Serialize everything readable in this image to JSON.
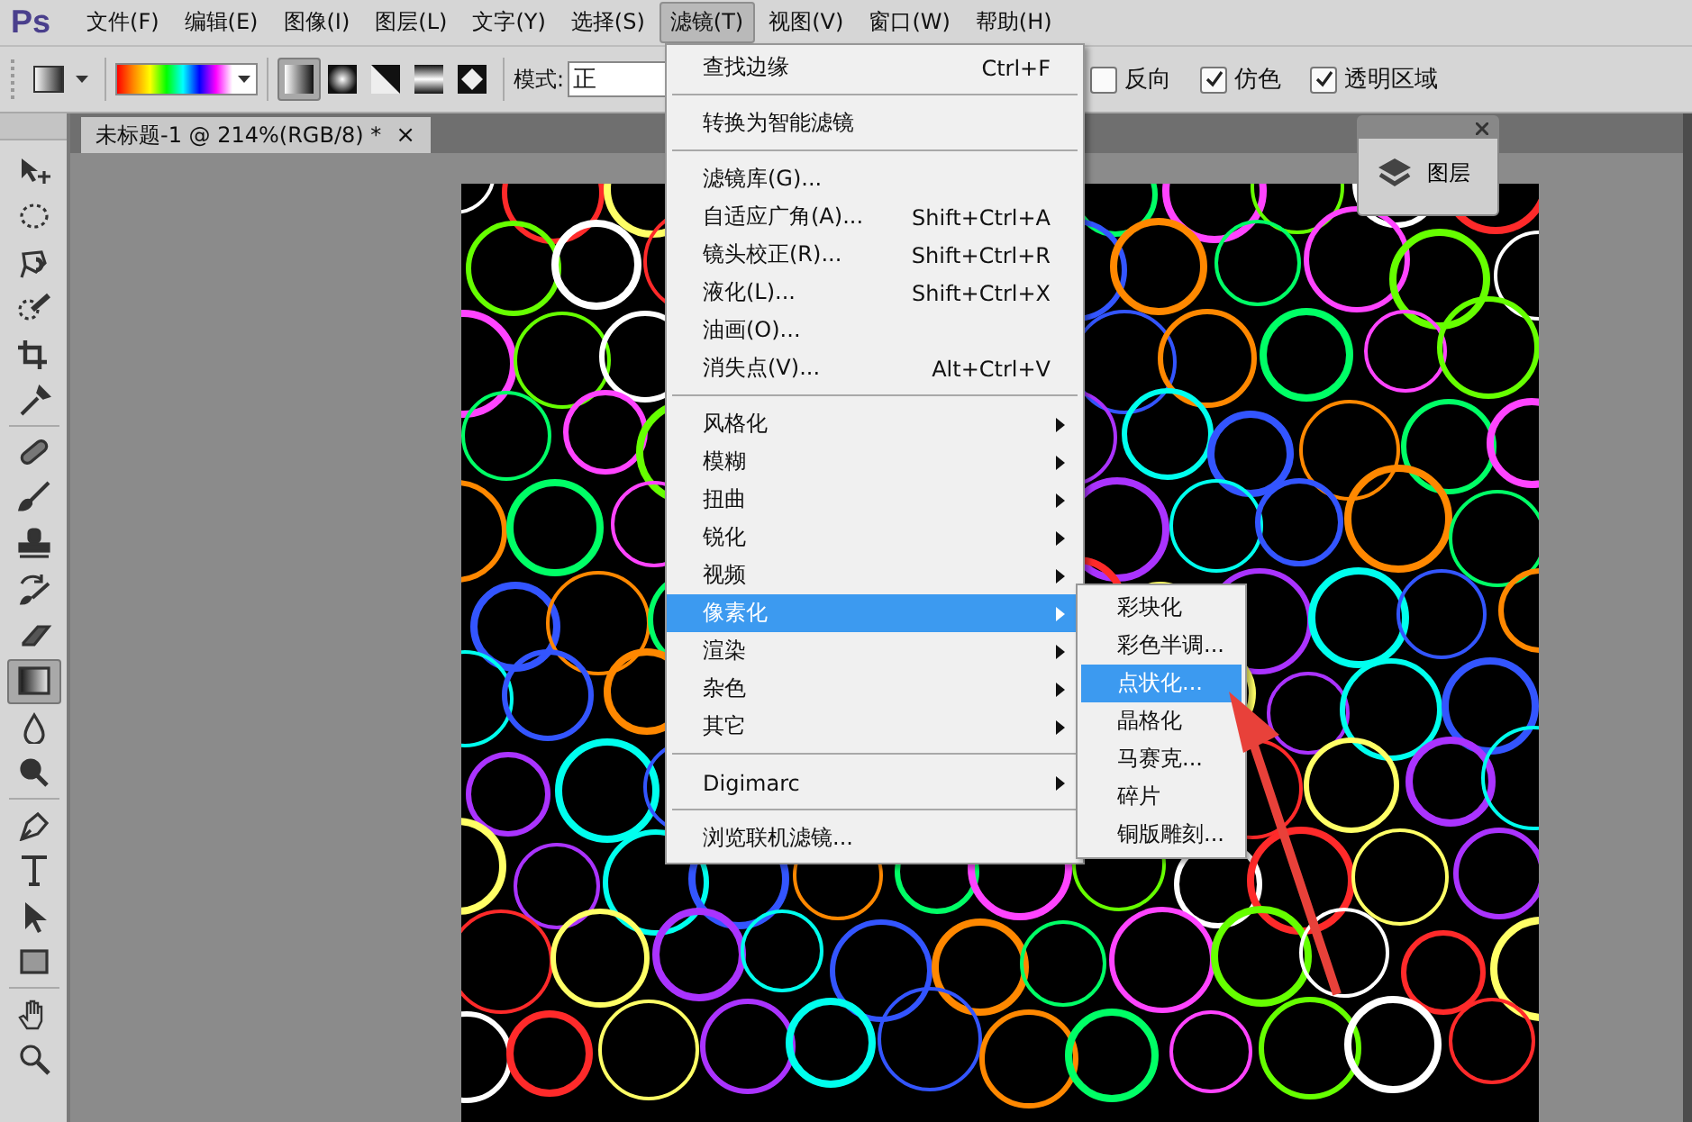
{
  "app_logo": "Ps",
  "menubar": [
    {
      "label": "文件(F)",
      "selected": false
    },
    {
      "label": "编辑(E)",
      "selected": false
    },
    {
      "label": "图像(I)",
      "selected": false
    },
    {
      "label": "图层(L)",
      "selected": false
    },
    {
      "label": "文字(Y)",
      "selected": false
    },
    {
      "label": "选择(S)",
      "selected": false
    },
    {
      "label": "滤镜(T)",
      "selected": true
    },
    {
      "label": "视图(V)",
      "selected": false
    },
    {
      "label": "窗口(W)",
      "selected": false
    },
    {
      "label": "帮助(H)",
      "selected": false
    }
  ],
  "options_bar": {
    "gradient_types": [
      {
        "kind": "linear",
        "selected": true
      },
      {
        "kind": "radial",
        "selected": false
      },
      {
        "kind": "angle",
        "selected": false
      },
      {
        "kind": "reflected",
        "selected": false
      },
      {
        "kind": "diamond",
        "selected": false
      }
    ],
    "mode_label": "模式:",
    "mode_value": "正",
    "checkboxes": [
      {
        "label": "反向",
        "checked": false
      },
      {
        "label": "仿色",
        "checked": true
      },
      {
        "label": "透明区域",
        "checked": true
      }
    ]
  },
  "document_tab": {
    "title": "未标题-1 @ 214%(RGB/8) *",
    "close": "×"
  },
  "tools": [
    {
      "kind": "move",
      "selected": false
    },
    {
      "kind": "marquee",
      "selected": false
    },
    {
      "kind": "lasso",
      "selected": false
    },
    {
      "kind": "quick-select",
      "selected": false
    },
    {
      "kind": "crop",
      "selected": false
    },
    {
      "kind": "eyedropper",
      "selected": false
    },
    {
      "kind": "sep"
    },
    {
      "kind": "healing",
      "selected": false
    },
    {
      "kind": "brush",
      "selected": false
    },
    {
      "kind": "stamp",
      "selected": false
    },
    {
      "kind": "history",
      "selected": false
    },
    {
      "kind": "eraser",
      "selected": false
    },
    {
      "kind": "gradient",
      "selected": true
    },
    {
      "kind": "blur",
      "selected": false
    },
    {
      "kind": "dodge",
      "selected": false
    },
    {
      "kind": "sep"
    },
    {
      "kind": "pen",
      "selected": false
    },
    {
      "kind": "type",
      "selected": false
    },
    {
      "kind": "path-select",
      "selected": false
    },
    {
      "kind": "rectangle",
      "selected": false
    },
    {
      "kind": "sep"
    },
    {
      "kind": "hand",
      "selected": false
    },
    {
      "kind": "zoom",
      "selected": false
    }
  ],
  "layers_panel": {
    "label": "图层"
  },
  "filter_menu": [
    [
      {
        "label": "查找边缘",
        "shortcut": "Ctrl+F",
        "submenu": false,
        "selected": false
      }
    ],
    [
      {
        "label": "转换为智能滤镜",
        "submenu": false,
        "selected": false
      }
    ],
    [
      {
        "label": "滤镜库(G)...",
        "submenu": false,
        "selected": false
      },
      {
        "label": "自适应广角(A)...",
        "shortcut": "Shift+Ctrl+A",
        "submenu": false,
        "selected": false
      },
      {
        "label": "镜头校正(R)...",
        "shortcut": "Shift+Ctrl+R",
        "submenu": false,
        "selected": false
      },
      {
        "label": "液化(L)...",
        "shortcut": "Shift+Ctrl+X",
        "submenu": false,
        "selected": false
      },
      {
        "label": "油画(O)...",
        "submenu": false,
        "selected": false
      },
      {
        "label": "消失点(V)...",
        "shortcut": "Alt+Ctrl+V",
        "submenu": false,
        "selected": false
      }
    ],
    [
      {
        "label": "风格化",
        "submenu": true,
        "selected": false
      },
      {
        "label": "模糊",
        "submenu": true,
        "selected": false
      },
      {
        "label": "扭曲",
        "submenu": true,
        "selected": false
      },
      {
        "label": "锐化",
        "submenu": true,
        "selected": false
      },
      {
        "label": "视频",
        "submenu": true,
        "selected": false
      },
      {
        "label": "像素化",
        "submenu": true,
        "selected": true
      },
      {
        "label": "渲染",
        "submenu": true,
        "selected": false
      },
      {
        "label": "杂色",
        "submenu": true,
        "selected": false
      },
      {
        "label": "其它",
        "submenu": true,
        "selected": false
      }
    ],
    [
      {
        "label": "Digimarc",
        "submenu": true,
        "selected": false
      }
    ],
    [
      {
        "label": "浏览联机滤镜...",
        "submenu": false,
        "selected": false
      }
    ]
  ],
  "pixelate_submenu": [
    {
      "label": "彩块化",
      "selected": false
    },
    {
      "label": "彩色半调...",
      "selected": false
    },
    {
      "label": "点状化...",
      "selected": true
    },
    {
      "label": "晶格化",
      "selected": false
    },
    {
      "label": "马赛克...",
      "selected": false
    },
    {
      "label": "碎片",
      "selected": false
    },
    {
      "label": "铜版雕刻...",
      "selected": false
    }
  ]
}
